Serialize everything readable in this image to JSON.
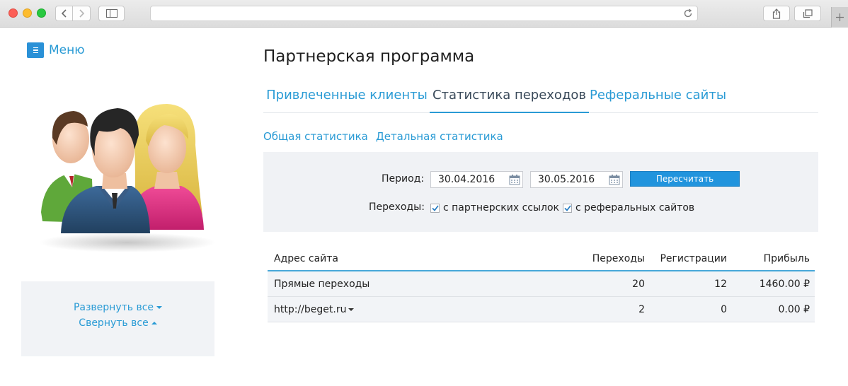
{
  "sidebar": {
    "menu_label": "Меню",
    "expand_all": "Развернуть все",
    "collapse_all": "Свернуть все"
  },
  "page": {
    "title": "Партнерская программа",
    "tabs": [
      {
        "label": "Привлеченные клиенты",
        "active": false
      },
      {
        "label": "Статистика переходов",
        "active": true
      },
      {
        "label": "Реферальные сайты",
        "active": false
      }
    ],
    "subtabs": [
      "Общая статистика",
      "Детальная статистика"
    ]
  },
  "filter": {
    "period_label": "Период:",
    "date_from": "30.04.2016",
    "date_to": "30.05.2016",
    "recalc_label": "Пересчитать",
    "transitions_label": "Переходы:",
    "checkboxes": [
      {
        "label": "с партнерских ссылок",
        "checked": true
      },
      {
        "label": "с реферальных сайтов",
        "checked": true
      }
    ]
  },
  "table": {
    "headers": [
      "Адрес сайта",
      "Переходы",
      "Регистрации",
      "Прибыль"
    ],
    "rows": [
      [
        "Прямые переходы",
        "20",
        "12",
        "1460.00 ₽"
      ],
      [
        "http://beget.ru",
        "2",
        "0",
        "0.00 ₽"
      ]
    ]
  },
  "colors": {
    "accent": "#2a9bd5",
    "button": "#2194dd",
    "panel": "#f0f2f5"
  }
}
